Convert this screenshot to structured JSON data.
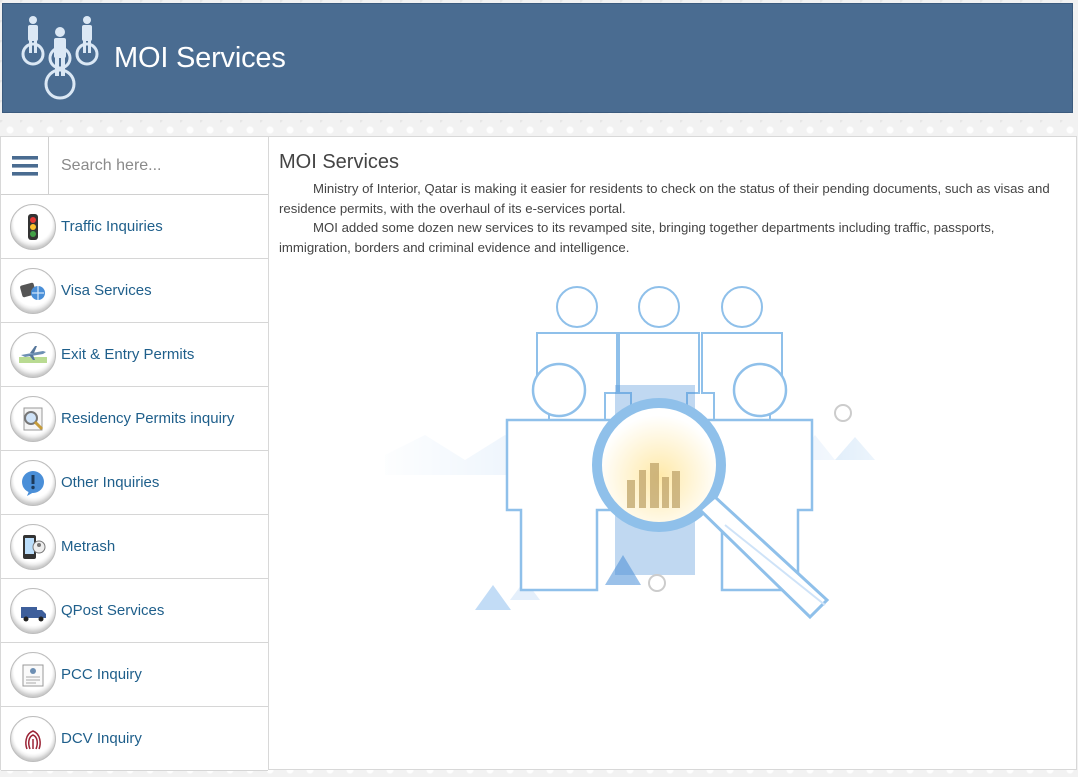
{
  "header": {
    "title": "MOI Services",
    "logo_icon": "people-network-logo-icon",
    "background_color": "#4a6c91"
  },
  "search": {
    "placeholder": "Search here...",
    "value": ""
  },
  "menu_icon": "hamburger-menu-icon",
  "sidebar": {
    "items": [
      {
        "label": "Traffic Inquiries",
        "icon": "traffic-light-icon"
      },
      {
        "label": "Visa Services",
        "icon": "visa-passport-icon"
      },
      {
        "label": "Exit & Entry Permits",
        "icon": "airplane-icon"
      },
      {
        "label": "Residency Permits inquiry",
        "icon": "magnifier-document-icon"
      },
      {
        "label": "Other Inquiries",
        "icon": "exclamation-bubble-icon"
      },
      {
        "label": "Metrash",
        "icon": "metrash-app-icon"
      },
      {
        "label": "QPost Services",
        "icon": "delivery-van-icon"
      },
      {
        "label": "PCC Inquiry",
        "icon": "certificate-icon"
      },
      {
        "label": "DCV Inquiry",
        "icon": "fingerprint-icon"
      }
    ]
  },
  "main": {
    "title": "MOI Services",
    "paragraphs": [
      "Ministry of Interior, Qatar is making it easier for residents to check on the status of their pending documents, such as visas and residence permits, with the overhaul of its e-services portal.",
      "MOI added some dozen new services to its revamped site, bringing together departments including traffic, passports, immigration, borders and criminal evidence and intelligence."
    ],
    "hero_image": "people-magnifier-illustration"
  },
  "colors": {
    "link": "#1f5f8b",
    "accent": "#4a6c91",
    "illustration": "#4a8fd8"
  }
}
